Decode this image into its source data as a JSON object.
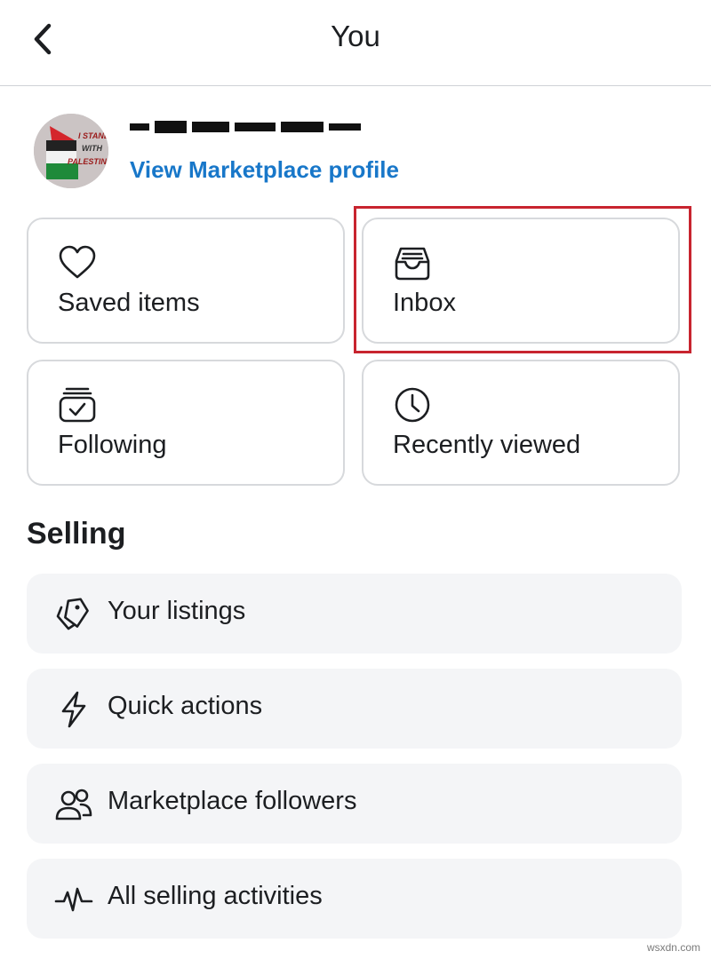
{
  "header": {
    "title": "You",
    "back_icon": "chevron-left-icon"
  },
  "profile": {
    "name": "[redacted]",
    "link_label": "View Marketplace profile",
    "avatar_text": [
      "I STAND",
      "WITH",
      "PALESTINE"
    ]
  },
  "cards": [
    {
      "label": "Saved items",
      "icon": "heart-icon"
    },
    {
      "label": "Inbox",
      "icon": "inbox-icon"
    },
    {
      "label": "Following",
      "icon": "following-icon"
    },
    {
      "label": "Recently viewed",
      "icon": "clock-icon"
    }
  ],
  "selling": {
    "title": "Selling",
    "items": [
      {
        "label": "Your listings",
        "icon": "tag-icon"
      },
      {
        "label": "Quick actions",
        "icon": "lightning-icon"
      },
      {
        "label": "Marketplace followers",
        "icon": "people-icon"
      },
      {
        "label": "All selling activities",
        "icon": "activity-icon"
      }
    ]
  },
  "watermark": "wsxdn.com",
  "colors": {
    "accent": "#1877c9",
    "highlight": "#c8242f",
    "row_bg": "#f4f5f7",
    "card_border": "#d7d9dc"
  }
}
